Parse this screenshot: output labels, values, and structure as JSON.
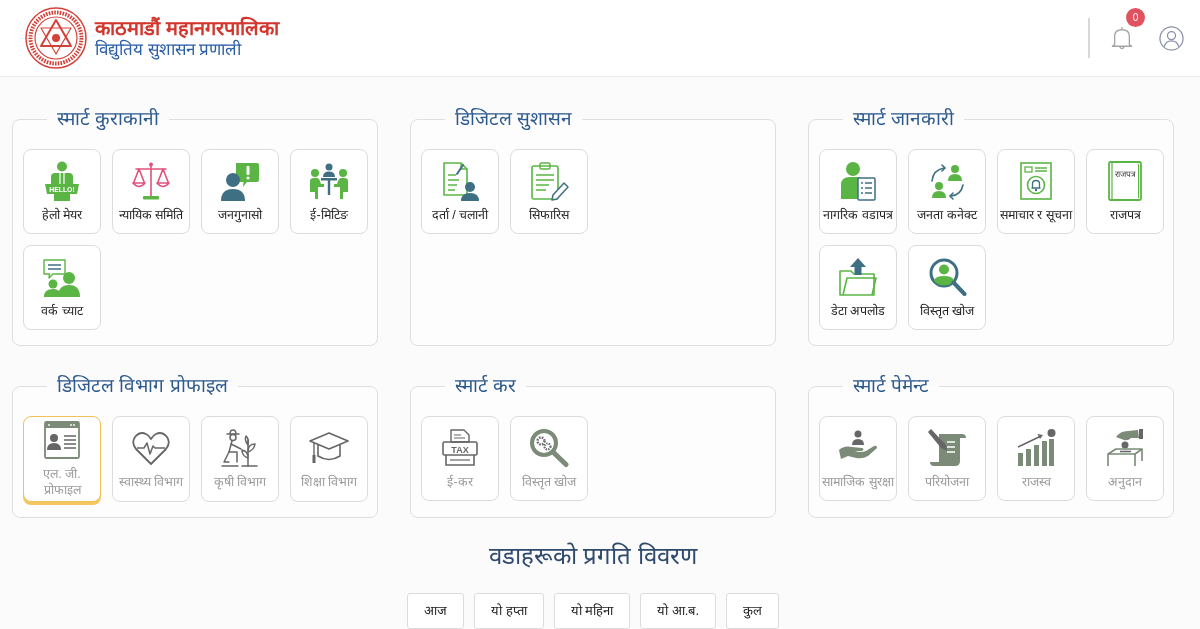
{
  "header": {
    "title": "काठमाडौं महानगरपालिका",
    "subtitle": "विद्युतिय सुशासन प्रणाली",
    "notification_count": "0"
  },
  "panels": [
    {
      "title": "स्मार्ट कुराकानी",
      "tiles": [
        {
          "label": "हेलो मेयर",
          "icon_label": "HELLO!",
          "selected": false,
          "disabled": false
        },
        {
          "label": "न्यायिक समिति",
          "selected": false,
          "disabled": false
        },
        {
          "label": "जनगुनासो",
          "selected": false,
          "disabled": false
        },
        {
          "label": "ई-मिटिङ",
          "selected": false,
          "disabled": false
        },
        {
          "label": "वर्क च्याट",
          "selected": false,
          "disabled": false
        }
      ]
    },
    {
      "title": "डिजिटल सुशासन",
      "tiles": [
        {
          "label": "दर्ता / चलानी",
          "selected": false,
          "disabled": false
        },
        {
          "label": "सिफारिस",
          "selected": false,
          "disabled": false
        }
      ]
    },
    {
      "title": "स्मार्ट जानकारी",
      "tiles": [
        {
          "label": "नागरिक वडापत्र",
          "selected": false,
          "disabled": false
        },
        {
          "label": "जनता कनेक्ट",
          "selected": false,
          "disabled": false
        },
        {
          "label": "समाचार र सूचना",
          "selected": false,
          "disabled": false
        },
        {
          "label": "राजपत्र",
          "icon_label": "राजपत्र",
          "selected": false,
          "disabled": false
        },
        {
          "label": "डेटा अपलोड",
          "selected": false,
          "disabled": false
        },
        {
          "label": "विस्तृत खोज",
          "selected": false,
          "disabled": false
        }
      ]
    },
    {
      "title": "डिजिटल विभाग प्रोफाइल",
      "tiles": [
        {
          "label": "एल. जी. प्रोफाइल",
          "selected": true,
          "disabled": true
        },
        {
          "label": "स्वास्थ्य विभाग",
          "selected": false,
          "disabled": true
        },
        {
          "label": "कृषी विभाग",
          "selected": false,
          "disabled": true
        },
        {
          "label": "शिक्षा विभाग",
          "selected": false,
          "disabled": true
        }
      ]
    },
    {
      "title": "स्मार्ट कर",
      "tiles": [
        {
          "label": "ई-कर",
          "icon_label": "TAX",
          "selected": false,
          "disabled": true
        },
        {
          "label": "विस्तृत खोज",
          "selected": false,
          "disabled": true
        }
      ]
    },
    {
      "title": "स्मार्ट पेमेन्ट",
      "tiles": [
        {
          "label": "सामाजिक सुरक्षा",
          "selected": false,
          "disabled": true
        },
        {
          "label": "परियोजना",
          "selected": false,
          "disabled": true
        },
        {
          "label": "राजस्व",
          "selected": false,
          "disabled": true
        },
        {
          "label": "अनुदान",
          "selected": false,
          "disabled": true
        }
      ]
    }
  ],
  "progress": {
    "title": "वडाहरूको प्रगति विवरण",
    "periods": [
      "आज",
      "यो हप्ता",
      "यो महिना",
      "यो आ.ब.",
      "कुल"
    ]
  }
}
